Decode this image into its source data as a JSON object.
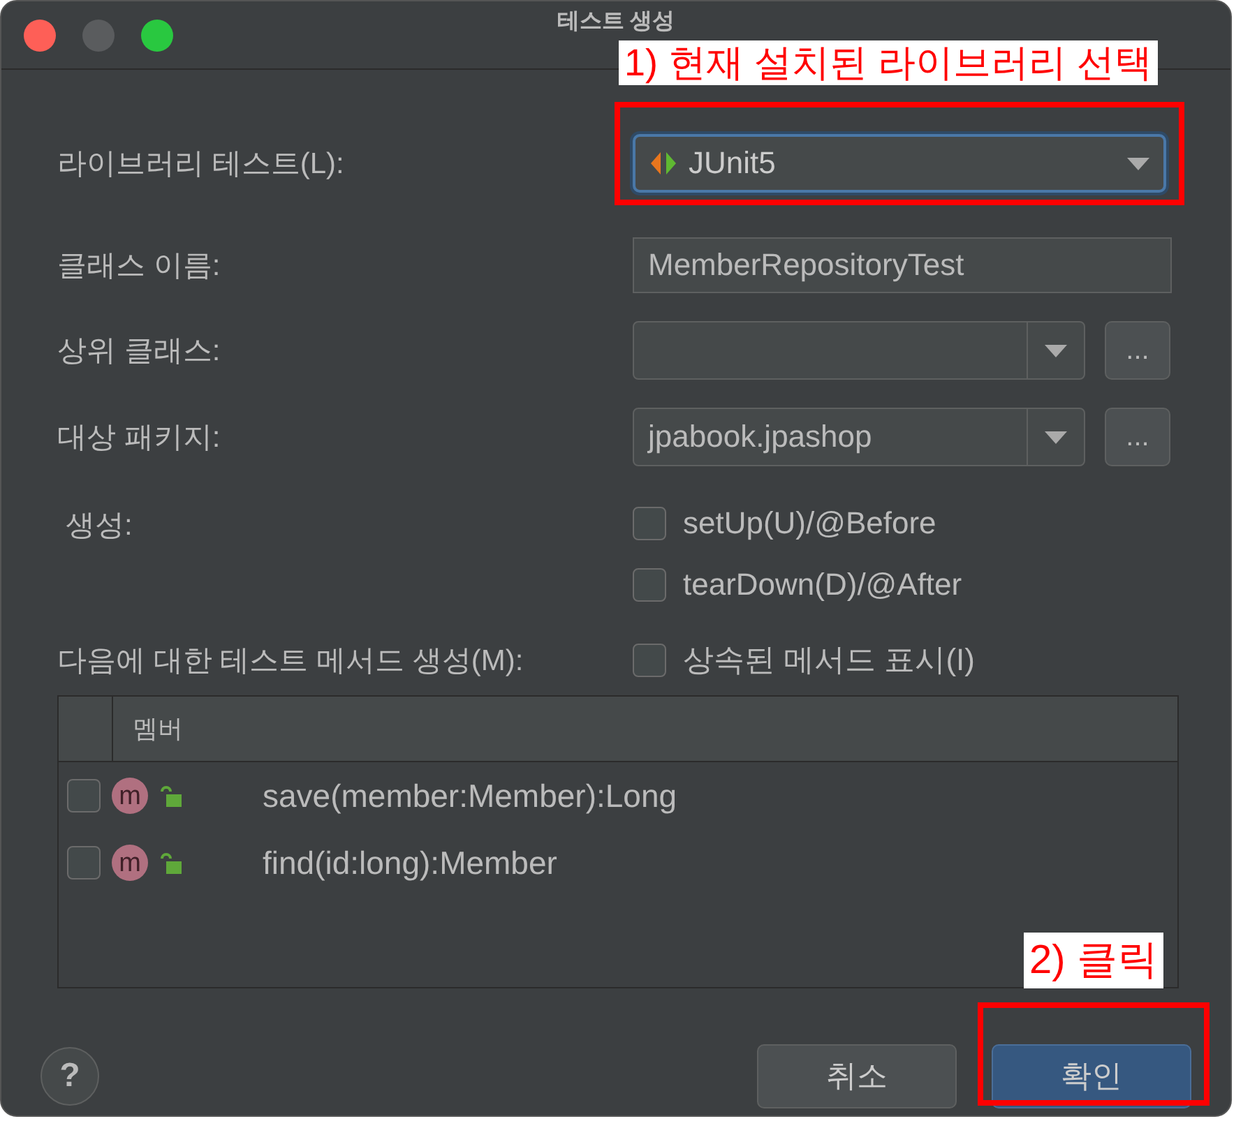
{
  "window": {
    "title": "테스트 생성"
  },
  "annotations": [
    {
      "text": "1) 현재 설치된 라이브러리 선택"
    },
    {
      "text": "2) 클릭"
    }
  ],
  "library": {
    "label": "라이브러리 테스트(L):",
    "value": "JUnit5"
  },
  "class_name": {
    "label": "클래스 이름:",
    "value": "MemberRepositoryTest"
  },
  "superclass": {
    "label": "상위 클래스:",
    "browse": "..."
  },
  "package": {
    "label": "대상 패키지:",
    "value": "jpabook.jpashop",
    "browse": "..."
  },
  "generate": {
    "label": "생성:",
    "options": [
      {
        "label": "setUp(U)/@Before",
        "checked": false
      },
      {
        "label": "tearDown(D)/@After",
        "checked": false
      }
    ]
  },
  "methods": {
    "label": "다음에 대한 테스트 메서드 생성(M):",
    "inherited": {
      "label": "상속된 메서드 표시(I)",
      "checked": false
    }
  },
  "table": {
    "column": "멤버",
    "rows": [
      {
        "icon_letter": "m",
        "label": "save(member:Member):Long",
        "checked": false
      },
      {
        "icon_letter": "m",
        "label": "find(id:long):Member",
        "checked": false
      }
    ]
  },
  "help": "?",
  "buttons": [
    {
      "kind": "cancel",
      "label": "취소"
    },
    {
      "kind": "ok",
      "label": "확인"
    }
  ]
}
